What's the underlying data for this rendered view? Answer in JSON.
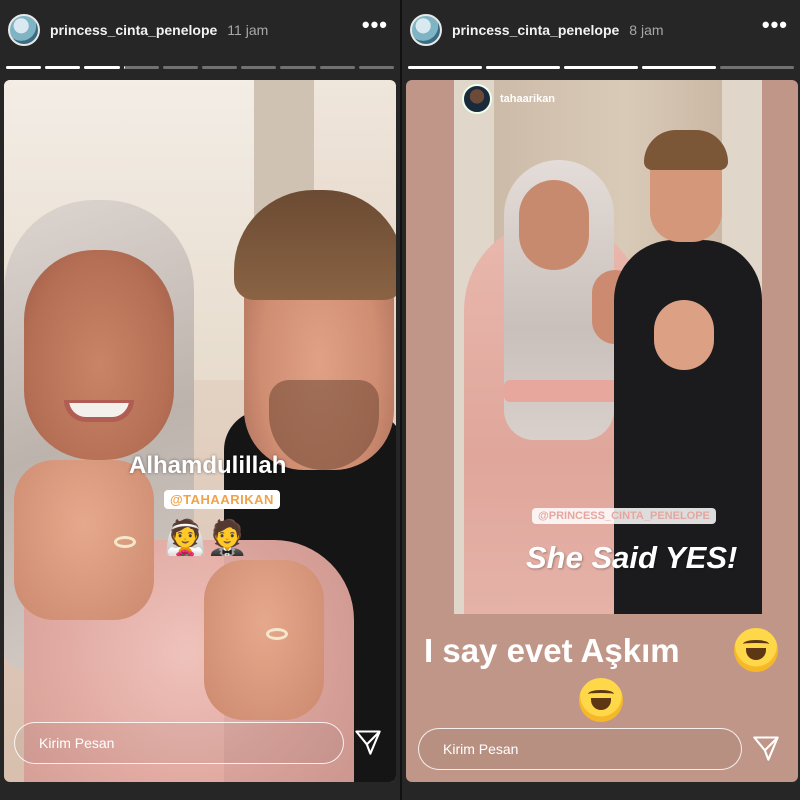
{
  "left_story": {
    "username": "princess_cinta_penelope",
    "time": "11 jam",
    "progress": [
      1,
      1,
      1,
      0.05,
      0,
      0,
      0,
      0,
      0,
      0
    ],
    "caption": "Alhamdulillah",
    "mention": "@TAHAARIKAN",
    "emojis": "👰🤵",
    "message_placeholder": "Kirim Pesan"
  },
  "right_story": {
    "username": "princess_cinta_penelope",
    "time": "8 jam",
    "progress": [
      1,
      1,
      1,
      1,
      0
    ],
    "reshared_user": "tahaarikan",
    "mention": "@PRINCESS_CINTA_PENELOPE",
    "headline": "She Said YES!",
    "caption": "I say evet Aşkım",
    "message_placeholder": "Kirim Pesan"
  },
  "icons": {
    "more": "more-icon",
    "send": "send-icon",
    "laugh": "rolling-on-floor-laughing-emoji"
  },
  "colors": {
    "background": "#262626",
    "right_story_bg": "#c09688",
    "mention_orange": "#f0a24a"
  }
}
